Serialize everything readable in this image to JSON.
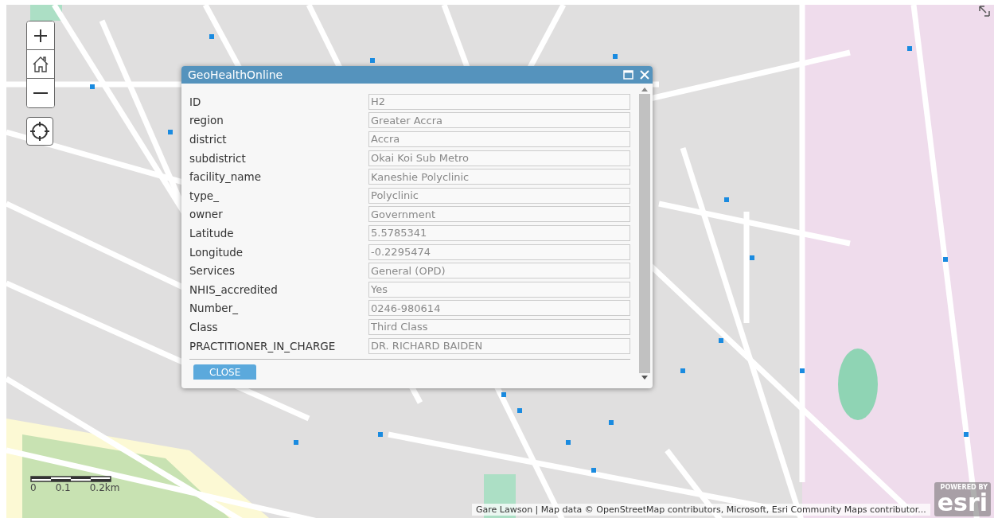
{
  "popup": {
    "title": "GeoHealthOnline",
    "fields": [
      {
        "label": "ID",
        "value": "H2"
      },
      {
        "label": "region",
        "value": "Greater Accra"
      },
      {
        "label": "district",
        "value": "Accra"
      },
      {
        "label": "subdistrict",
        "value": "Okai Koi Sub Metro"
      },
      {
        "label": "facility_name",
        "value": "Kaneshie Polyclinic"
      },
      {
        "label": "type_",
        "value": "Polyclinic"
      },
      {
        "label": "owner",
        "value": "Government"
      },
      {
        "label": "Latitude",
        "value": "5.5785341"
      },
      {
        "label": "Longitude",
        "value": "-0.2295474"
      },
      {
        "label": "Services",
        "value": "General (OPD)"
      },
      {
        "label": "NHIS_accredited",
        "value": "Yes"
      },
      {
        "label": "Number_",
        "value": "0246-980614"
      },
      {
        "label": "Class",
        "value": "Third Class"
      },
      {
        "label": "PRACTITIONER_IN_CHARGE",
        "value": "DR. RICHARD BAIDEN"
      }
    ],
    "close_button": "CLOSE"
  },
  "scale_bar": {
    "labels": [
      "0",
      "0.1",
      "0.2km"
    ]
  },
  "attribution": "Gare Lawson | Map data © OpenStreetMap contributors, Microsoft, Esri Community Maps contributor...",
  "esri_logo": {
    "caption": "POWERED BY",
    "wordmark": "esri"
  }
}
